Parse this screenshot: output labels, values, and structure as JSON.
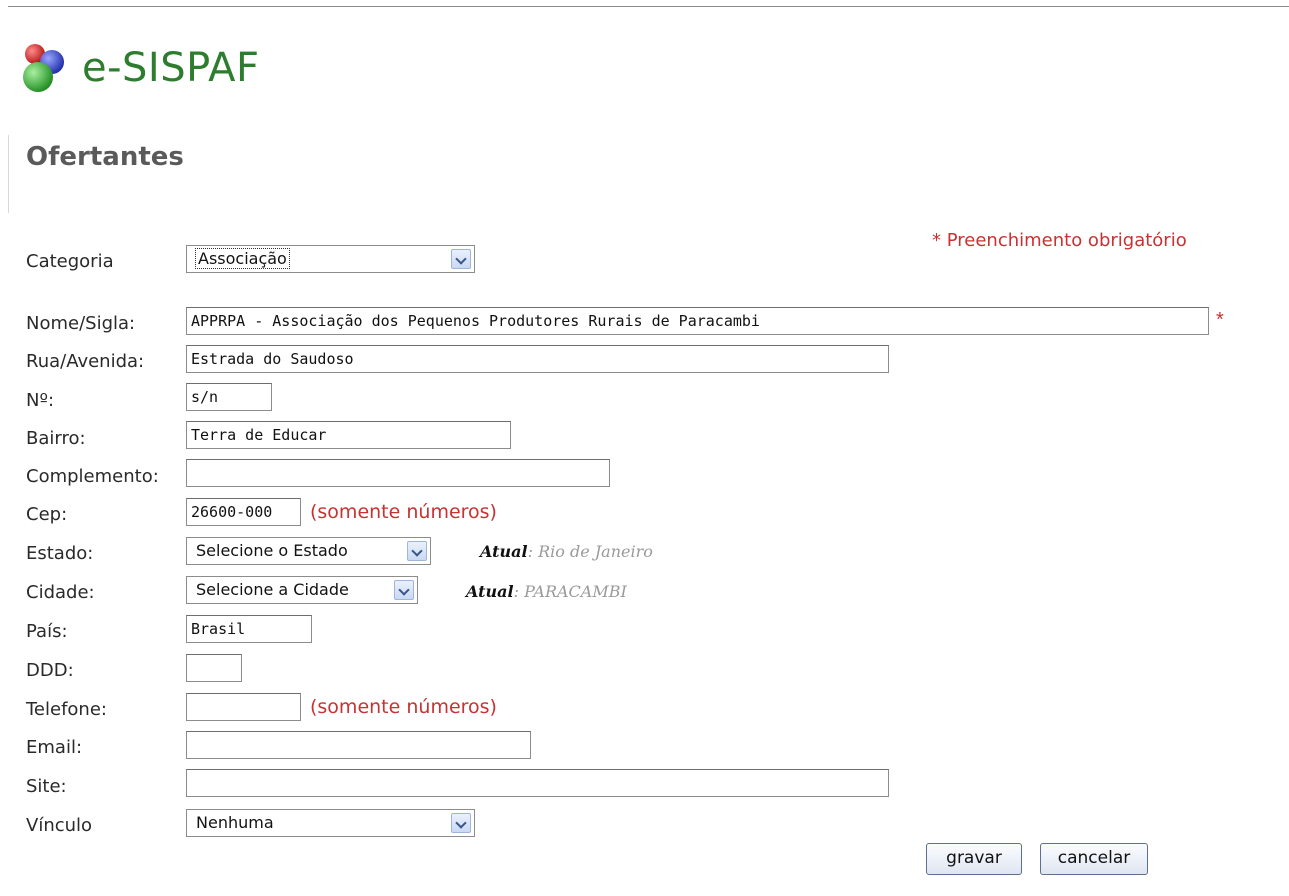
{
  "app": {
    "name": "e-SISPAF"
  },
  "page": {
    "title": "Ofertantes",
    "required_note": "* Preenchimento obrigatório"
  },
  "form": {
    "categoria": {
      "label": "Categoria",
      "value": "Associação"
    },
    "nome": {
      "label": "Nome/Sigla:",
      "value": "APPRPA - Associação dos Pequenos Produtores Rurais de Paracambi",
      "required_mark": "*"
    },
    "rua": {
      "label": "Rua/Avenida:",
      "value": "Estrada do Saudoso"
    },
    "numero": {
      "label": "Nº:",
      "value": "s/n"
    },
    "bairro": {
      "label": "Bairro:",
      "value": "Terra de Educar"
    },
    "complemento": {
      "label": "Complemento:",
      "value": ""
    },
    "cep": {
      "label": "Cep:",
      "value": "26600-000",
      "hint": "(somente números)"
    },
    "estado": {
      "label": "Estado:",
      "value": "Selecione o Estado",
      "atual_label": "Atual",
      "atual_value": ": Rio de Janeiro"
    },
    "cidade": {
      "label": "Cidade:",
      "value": "Selecione a Cidade",
      "atual_label": "Atual",
      "atual_value": ": PARACAMBI"
    },
    "pais": {
      "label": "País:",
      "value": "Brasil"
    },
    "ddd": {
      "label": "DDD:",
      "value": ""
    },
    "telefone": {
      "label": "Telefone:",
      "value": "",
      "hint": "(somente números)"
    },
    "email": {
      "label": "Email:",
      "value": ""
    },
    "site": {
      "label": "Site:",
      "value": ""
    },
    "vinculo": {
      "label": "Vínculo",
      "value": "Nenhuma"
    }
  },
  "buttons": {
    "save": "gravar",
    "cancel": "cancelar"
  },
  "colors": {
    "required": "#c83232",
    "logo_text": "#2e7d2e",
    "title": "#5a5a5a"
  }
}
